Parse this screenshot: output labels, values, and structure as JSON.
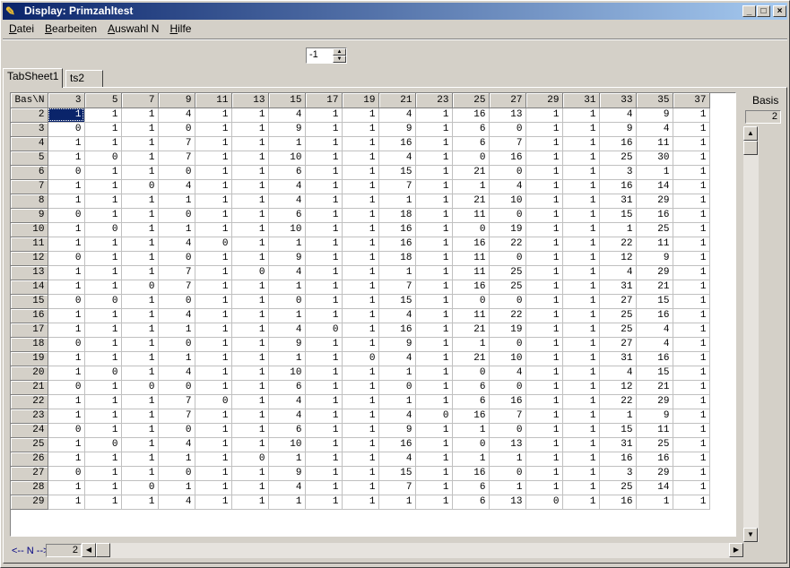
{
  "window": {
    "title": "Display: Primzahltest"
  },
  "menu": [
    {
      "label": "Datei",
      "ul": "D",
      "rest": "atei"
    },
    {
      "label": "Bearbeiten",
      "ul": "B",
      "rest": "earbeiten"
    },
    {
      "label": "Auswahl N",
      "ul": "A",
      "rest": "uswahl N"
    },
    {
      "label": "Hilfe",
      "ul": "H",
      "rest": "ilfe"
    }
  ],
  "spinner": {
    "value": "-1"
  },
  "tabs": [
    "TabSheet1",
    "ts2"
  ],
  "basis": {
    "label": "Basis",
    "value": "2"
  },
  "n_nav": {
    "label": "<-- N -->",
    "value": "2"
  },
  "grid": {
    "corner": "Bas\\N",
    "columns": [
      "3",
      "5",
      "7",
      "9",
      "11",
      "13",
      "15",
      "17",
      "19",
      "21",
      "23",
      "25",
      "27",
      "29",
      "31",
      "33",
      "35",
      "37"
    ],
    "rows": [
      {
        "b": "2",
        "v": [
          "1",
          "1",
          "1",
          "4",
          "1",
          "1",
          "4",
          "1",
          "1",
          "4",
          "1",
          "16",
          "13",
          "1",
          "1",
          "4",
          "9",
          "1"
        ]
      },
      {
        "b": "3",
        "v": [
          "0",
          "1",
          "1",
          "0",
          "1",
          "1",
          "9",
          "1",
          "1",
          "9",
          "1",
          "6",
          "0",
          "1",
          "1",
          "9",
          "4",
          "1"
        ]
      },
      {
        "b": "4",
        "v": [
          "1",
          "1",
          "1",
          "7",
          "1",
          "1",
          "1",
          "1",
          "1",
          "16",
          "1",
          "6",
          "7",
          "1",
          "1",
          "16",
          "11",
          "1"
        ]
      },
      {
        "b": "5",
        "v": [
          "1",
          "0",
          "1",
          "7",
          "1",
          "1",
          "10",
          "1",
          "1",
          "4",
          "1",
          "0",
          "16",
          "1",
          "1",
          "25",
          "30",
          "1"
        ]
      },
      {
        "b": "6",
        "v": [
          "0",
          "1",
          "1",
          "0",
          "1",
          "1",
          "6",
          "1",
          "1",
          "15",
          "1",
          "21",
          "0",
          "1",
          "1",
          "3",
          "1",
          "1"
        ]
      },
      {
        "b": "7",
        "v": [
          "1",
          "1",
          "0",
          "4",
          "1",
          "1",
          "4",
          "1",
          "1",
          "7",
          "1",
          "1",
          "4",
          "1",
          "1",
          "16",
          "14",
          "1"
        ]
      },
      {
        "b": "8",
        "v": [
          "1",
          "1",
          "1",
          "1",
          "1",
          "1",
          "4",
          "1",
          "1",
          "1",
          "1",
          "21",
          "10",
          "1",
          "1",
          "31",
          "29",
          "1"
        ]
      },
      {
        "b": "9",
        "v": [
          "0",
          "1",
          "1",
          "0",
          "1",
          "1",
          "6",
          "1",
          "1",
          "18",
          "1",
          "11",
          "0",
          "1",
          "1",
          "15",
          "16",
          "1"
        ]
      },
      {
        "b": "10",
        "v": [
          "1",
          "0",
          "1",
          "1",
          "1",
          "1",
          "10",
          "1",
          "1",
          "16",
          "1",
          "0",
          "19",
          "1",
          "1",
          "1",
          "25",
          "1"
        ]
      },
      {
        "b": "11",
        "v": [
          "1",
          "1",
          "1",
          "4",
          "0",
          "1",
          "1",
          "1",
          "1",
          "16",
          "1",
          "16",
          "22",
          "1",
          "1",
          "22",
          "11",
          "1"
        ]
      },
      {
        "b": "12",
        "v": [
          "0",
          "1",
          "1",
          "0",
          "1",
          "1",
          "9",
          "1",
          "1",
          "18",
          "1",
          "11",
          "0",
          "1",
          "1",
          "12",
          "9",
          "1"
        ]
      },
      {
        "b": "13",
        "v": [
          "1",
          "1",
          "1",
          "7",
          "1",
          "0",
          "4",
          "1",
          "1",
          "1",
          "1",
          "11",
          "25",
          "1",
          "1",
          "4",
          "29",
          "1"
        ]
      },
      {
        "b": "14",
        "v": [
          "1",
          "1",
          "0",
          "7",
          "1",
          "1",
          "1",
          "1",
          "1",
          "7",
          "1",
          "16",
          "25",
          "1",
          "1",
          "31",
          "21",
          "1"
        ]
      },
      {
        "b": "15",
        "v": [
          "0",
          "0",
          "1",
          "0",
          "1",
          "1",
          "0",
          "1",
          "1",
          "15",
          "1",
          "0",
          "0",
          "1",
          "1",
          "27",
          "15",
          "1"
        ]
      },
      {
        "b": "16",
        "v": [
          "1",
          "1",
          "1",
          "4",
          "1",
          "1",
          "1",
          "1",
          "1",
          "4",
          "1",
          "11",
          "22",
          "1",
          "1",
          "25",
          "16",
          "1"
        ]
      },
      {
        "b": "17",
        "v": [
          "1",
          "1",
          "1",
          "1",
          "1",
          "1",
          "4",
          "0",
          "1",
          "16",
          "1",
          "21",
          "19",
          "1",
          "1",
          "25",
          "4",
          "1"
        ]
      },
      {
        "b": "18",
        "v": [
          "0",
          "1",
          "1",
          "0",
          "1",
          "1",
          "9",
          "1",
          "1",
          "9",
          "1",
          "1",
          "0",
          "1",
          "1",
          "27",
          "4",
          "1"
        ]
      },
      {
        "b": "19",
        "v": [
          "1",
          "1",
          "1",
          "1",
          "1",
          "1",
          "1",
          "1",
          "0",
          "4",
          "1",
          "21",
          "10",
          "1",
          "1",
          "31",
          "16",
          "1"
        ]
      },
      {
        "b": "20",
        "v": [
          "1",
          "0",
          "1",
          "4",
          "1",
          "1",
          "10",
          "1",
          "1",
          "1",
          "1",
          "0",
          "4",
          "1",
          "1",
          "4",
          "15",
          "1"
        ]
      },
      {
        "b": "21",
        "v": [
          "0",
          "1",
          "0",
          "0",
          "1",
          "1",
          "6",
          "1",
          "1",
          "0",
          "1",
          "6",
          "0",
          "1",
          "1",
          "12",
          "21",
          "1"
        ]
      },
      {
        "b": "22",
        "v": [
          "1",
          "1",
          "1",
          "7",
          "0",
          "1",
          "4",
          "1",
          "1",
          "1",
          "1",
          "6",
          "16",
          "1",
          "1",
          "22",
          "29",
          "1"
        ]
      },
      {
        "b": "23",
        "v": [
          "1",
          "1",
          "1",
          "7",
          "1",
          "1",
          "4",
          "1",
          "1",
          "4",
          "0",
          "16",
          "7",
          "1",
          "1",
          "1",
          "9",
          "1"
        ]
      },
      {
        "b": "24",
        "v": [
          "0",
          "1",
          "1",
          "0",
          "1",
          "1",
          "6",
          "1",
          "1",
          "9",
          "1",
          "1",
          "0",
          "1",
          "1",
          "15",
          "11",
          "1"
        ]
      },
      {
        "b": "25",
        "v": [
          "1",
          "0",
          "1",
          "4",
          "1",
          "1",
          "10",
          "1",
          "1",
          "16",
          "1",
          "0",
          "13",
          "1",
          "1",
          "31",
          "25",
          "1"
        ]
      },
      {
        "b": "26",
        "v": [
          "1",
          "1",
          "1",
          "1",
          "1",
          "0",
          "1",
          "1",
          "1",
          "4",
          "1",
          "1",
          "1",
          "1",
          "1",
          "16",
          "16",
          "1"
        ]
      },
      {
        "b": "27",
        "v": [
          "0",
          "1",
          "1",
          "0",
          "1",
          "1",
          "9",
          "1",
          "1",
          "15",
          "1",
          "16",
          "0",
          "1",
          "1",
          "3",
          "29",
          "1"
        ]
      },
      {
        "b": "28",
        "v": [
          "1",
          "1",
          "0",
          "1",
          "1",
          "1",
          "4",
          "1",
          "1",
          "7",
          "1",
          "6",
          "1",
          "1",
          "1",
          "25",
          "14",
          "1"
        ]
      },
      {
        "b": "29",
        "v": [
          "1",
          "1",
          "1",
          "4",
          "1",
          "1",
          "1",
          "1",
          "1",
          "1",
          "1",
          "6",
          "13",
          "0",
          "1",
          "16",
          "1",
          "1"
        ]
      }
    ]
  }
}
